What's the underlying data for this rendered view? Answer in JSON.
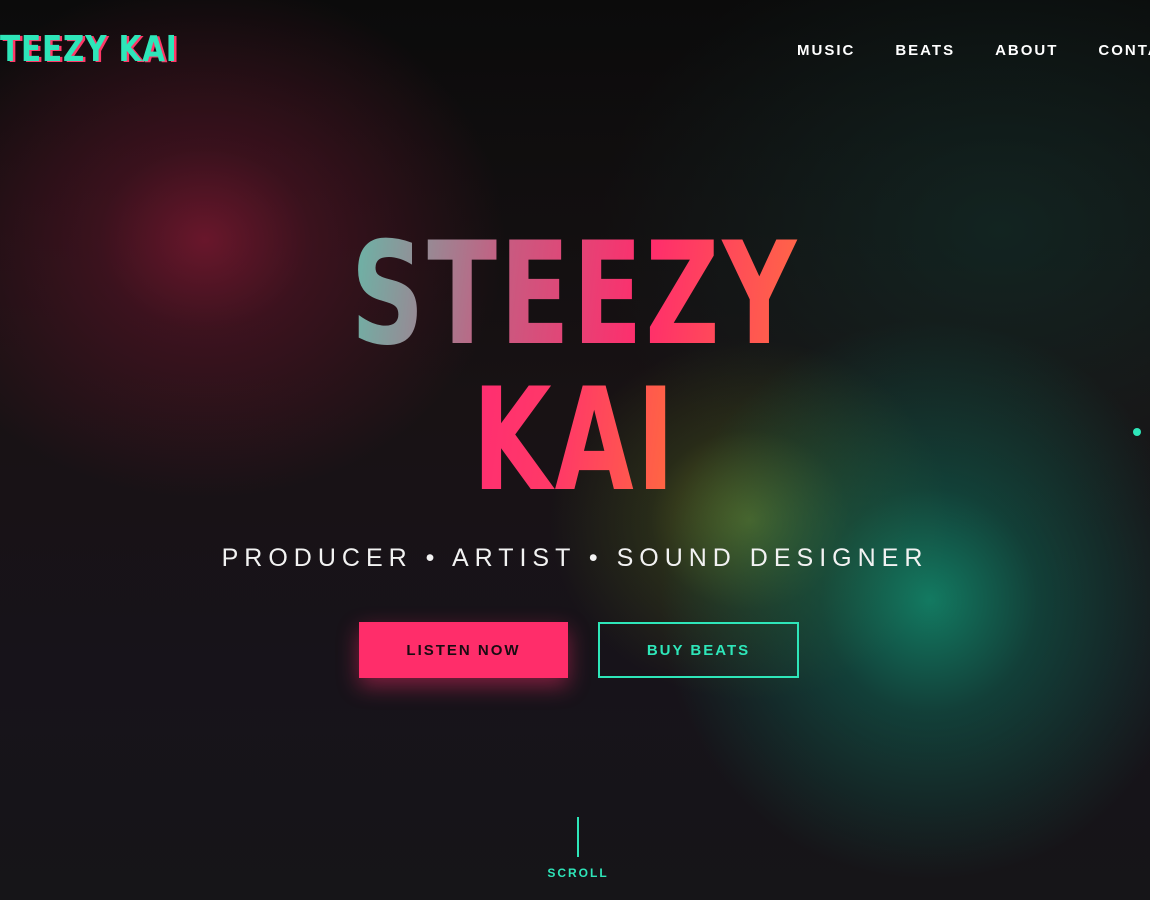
{
  "header": {
    "logo_text": "TEEZY KAI",
    "nav": [
      {
        "label": "MUSIC"
      },
      {
        "label": "BEATS"
      },
      {
        "label": "ABOUT"
      },
      {
        "label": "CONTA"
      }
    ]
  },
  "hero": {
    "title_line1": "STEEZY",
    "title_line2": "KAI",
    "subtitle": "PRODUCER • ARTIST • SOUND DESIGNER",
    "primary_button": "LISTEN NOW",
    "secondary_button": "BUY BEATS",
    "scroll_label": "SCROLL"
  },
  "colors": {
    "accent_pink": "#ff2d6a",
    "accent_teal": "#2ee6b9",
    "background": "#0c0c0d"
  },
  "icons": {
    "side_indicator": "dot-indicator-icon",
    "scroll": "scroll-line-icon"
  }
}
